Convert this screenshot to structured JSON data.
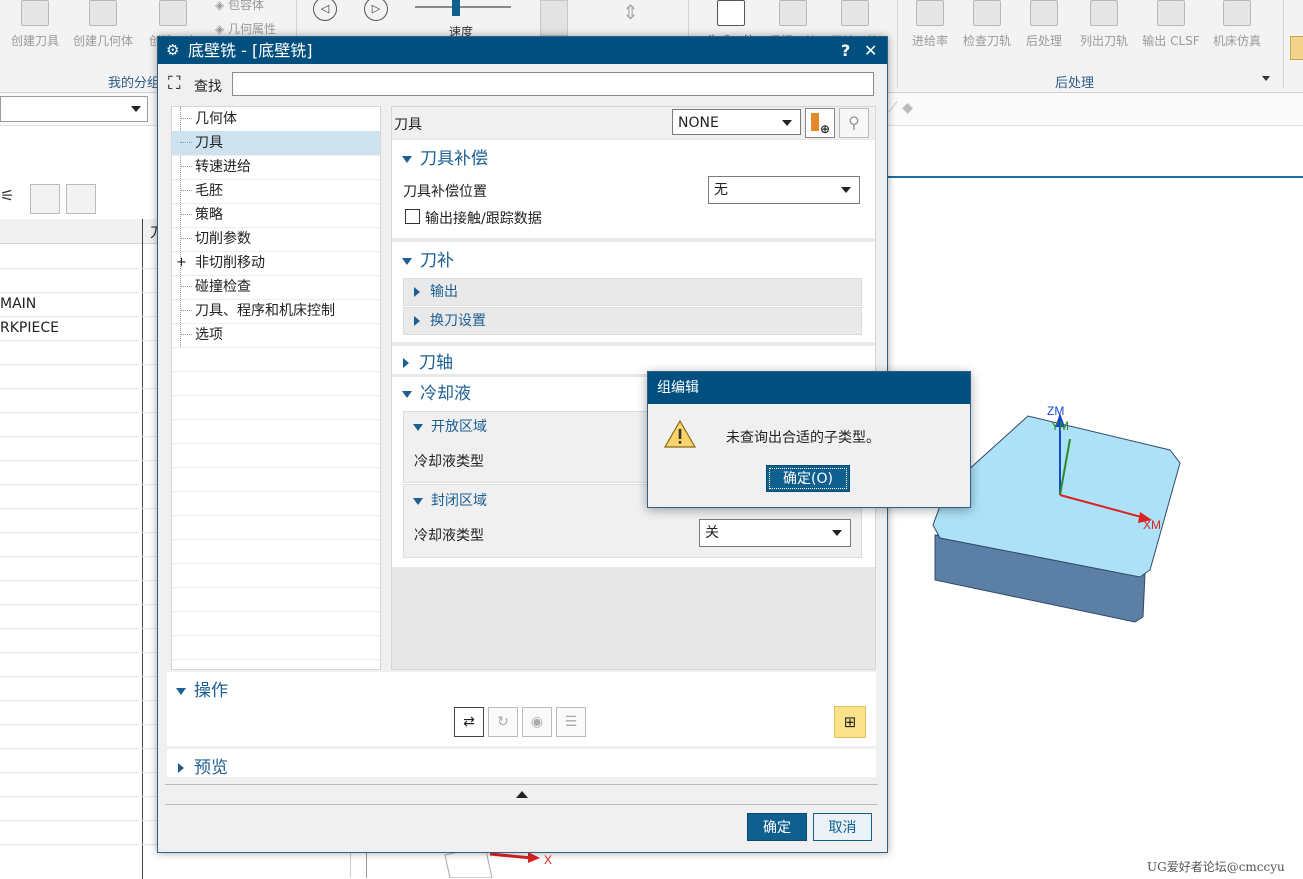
{
  "ribbon": {
    "left_buttons": [
      "创建刀具",
      "创建几何体",
      "创建工序"
    ],
    "small_items": [
      "包容体",
      "几何属性"
    ],
    "speed_label": "速度",
    "center_buttons": [
      "生成刀轨",
      "重播刀轨",
      "确认刀轨"
    ],
    "right_buttons": [
      "进给率",
      "检查刀轨",
      "后处理",
      "列出刀轨",
      "输出 CLSF",
      "机床仿真"
    ],
    "group_left": "我的分组",
    "group_right": "后处理"
  },
  "navigator": {
    "column_header": "刀",
    "rows": [
      "",
      "",
      "MAIN",
      "RKPIECE"
    ]
  },
  "dialog": {
    "title": "底壁铣 - [底壁铣]",
    "help": "?",
    "close": "✕",
    "search_label": "查找",
    "search_value": "",
    "tree": [
      {
        "label": "几何体",
        "selected": false,
        "expand": false
      },
      {
        "label": "刀具",
        "selected": true,
        "expand": false
      },
      {
        "label": "转速进给",
        "selected": false,
        "expand": false
      },
      {
        "label": "毛胚",
        "selected": false,
        "expand": false
      },
      {
        "label": "策略",
        "selected": false,
        "expand": false
      },
      {
        "label": "切削参数",
        "selected": false,
        "expand": false
      },
      {
        "label": "非切削移动",
        "selected": false,
        "expand": true
      },
      {
        "label": "碰撞检查",
        "selected": false,
        "expand": false
      },
      {
        "label": "刀具、程序和机床控制",
        "selected": false,
        "expand": false
      },
      {
        "label": "选项",
        "selected": false,
        "expand": false
      }
    ],
    "tool_label": "刀具",
    "tool_value": "NONE",
    "comp_section": "刀具补偿",
    "comp_pos_label": "刀具补偿位置",
    "comp_pos_value": "无",
    "output_contact_label": "输出接触/跟踪数据",
    "offset_section": "刀补",
    "offset_output": "输出",
    "offset_change": "换刀设置",
    "axis_section": "刀轴",
    "coolant_section": "冷却液",
    "open_region": "开放区域",
    "coolant_type_label": "冷却液类型",
    "closed_region": "封闭区域",
    "coolant_type_label2": "冷却液类型",
    "coolant_type_value2": "关",
    "ops_section": "操作",
    "preview_section": "预览",
    "ok": "确定",
    "cancel": "取消"
  },
  "message": {
    "title": "组编辑",
    "text": "未查询出合适的子类型。",
    "ok": "确定(O)"
  },
  "graphics": {
    "zm": "ZM",
    "ym": "YM",
    "xm": "XM",
    "x": "X"
  },
  "watermark": "UG爱好者论坛@cmccyu"
}
